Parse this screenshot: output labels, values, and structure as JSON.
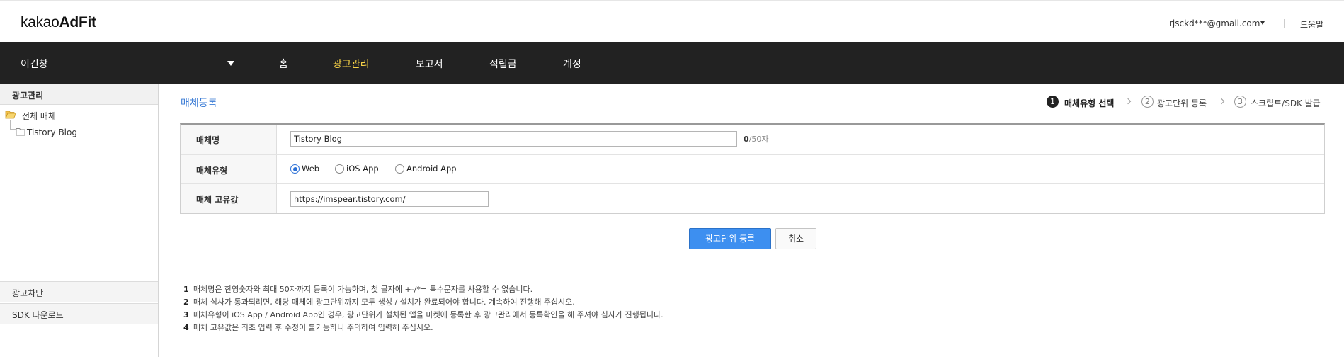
{
  "header": {
    "logo_light": "kakao",
    "logo_bold": "AdFit",
    "user_email": "rjsckd***@gmail.com",
    "help": "도움말"
  },
  "nav": {
    "account_name": "이건창",
    "items": [
      {
        "label": "홈",
        "active": false
      },
      {
        "label": "광고관리",
        "active": true
      },
      {
        "label": "보고서",
        "active": false
      },
      {
        "label": "적립금",
        "active": false
      },
      {
        "label": "계정",
        "active": false
      }
    ],
    "active_color": "#f8d347"
  },
  "sidebar": {
    "section_title": "광고관리",
    "tree": [
      {
        "label": "전체 매체",
        "icon": "folder-open-icon"
      },
      {
        "label": "Tistory Blog",
        "icon": "folder-icon"
      }
    ],
    "bottom_items": [
      "광고차단",
      "SDK 다운로드"
    ]
  },
  "main": {
    "page_title": "매체등록",
    "steps": [
      {
        "num": "1",
        "label": "매체유형 선택",
        "active": true
      },
      {
        "num": "2",
        "label": "광고단위 등록",
        "active": false
      },
      {
        "num": "3",
        "label": "스크립트/SDK 발급",
        "active": false
      }
    ],
    "form": {
      "name_label": "매체명",
      "name_value": "Tistory Blog",
      "name_count": "0",
      "name_limit": "/50자",
      "type_label": "매체유형",
      "type_options": [
        {
          "label": "Web",
          "checked": true
        },
        {
          "label": "iOS App",
          "checked": false
        },
        {
          "label": "Android App",
          "checked": false
        }
      ],
      "id_label": "매체 고유값",
      "id_value": "https://imspear.tistory.com/"
    },
    "buttons": {
      "submit": "광고단위 등록",
      "cancel": "취소"
    },
    "notes": [
      {
        "num": "1",
        "text": "매체명은 한영숫자와 최대 50자까지 등록이 가능하며, 첫 글자에 +-/*= 특수문자를 사용할 수 없습니다."
      },
      {
        "num": "2",
        "text": "매체 심사가 통과되려면, 해당 매체에 광고단위까지 모두 생성 / 설치가 완료되어야 합니다. 계속하여 진행해 주십시오."
      },
      {
        "num": "3",
        "text": "매체유형이 iOS App / Android App인 경우, 광고단위가 설치된 앱을 마켓에 등록한 후 광고관리에서 등록확인을 해 주셔야 심사가 진행됩니다."
      },
      {
        "num": "4",
        "text": "매체 고유값은 최초 입력 후 수정이 불가능하니 주의하여 입력해 주십시오."
      }
    ],
    "accent": "#3a7bd5",
    "primary_button_color": "#3d8ff0"
  }
}
